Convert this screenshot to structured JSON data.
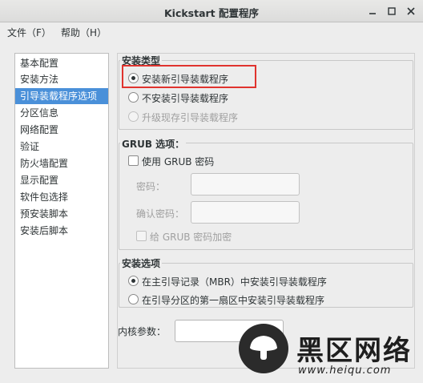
{
  "window": {
    "title": "Kickstart 配置程序"
  },
  "menubar": {
    "file": "文件（F）",
    "help": "帮助（H）"
  },
  "sidebar": {
    "items": [
      {
        "label": "基本配置"
      },
      {
        "label": "安装方法"
      },
      {
        "label": "引导装载程序选项",
        "selected": true
      },
      {
        "label": "分区信息"
      },
      {
        "label": "网络配置"
      },
      {
        "label": "验证"
      },
      {
        "label": "防火墙配置"
      },
      {
        "label": "显示配置"
      },
      {
        "label": "软件包选择"
      },
      {
        "label": "预安装脚本"
      },
      {
        "label": "安装后脚本"
      }
    ]
  },
  "install_type": {
    "legend": "安装类型",
    "options": [
      {
        "label": "安装新引导装载程序",
        "checked": true,
        "enabled": true
      },
      {
        "label": "不安装引导装载程序",
        "checked": false,
        "enabled": true
      },
      {
        "label": "升级现存引导装载程序",
        "checked": false,
        "enabled": false
      }
    ]
  },
  "grub": {
    "legend": "GRUB 选项：",
    "use_password_label": "使用  GRUB 密码",
    "password_label": "密码：",
    "password_value": "",
    "confirm_label": "确认密码：",
    "confirm_value": "",
    "encrypt_label": "给  GRUB 密码加密"
  },
  "install_options": {
    "legend": "安装选项",
    "options": [
      {
        "label": "在主引导记录（MBR）中安装引导装载程序",
        "checked": true
      },
      {
        "label": "在引导分区的第一扇区中安装引导装载程序",
        "checked": false
      }
    ]
  },
  "kernel": {
    "label": "内核参数：",
    "value": ""
  },
  "watermark": {
    "title": "黑区网络",
    "url": "www.heiqu.com"
  },
  "colors": {
    "selection": "#4a90d9",
    "highlight_box": "#e0332e"
  }
}
